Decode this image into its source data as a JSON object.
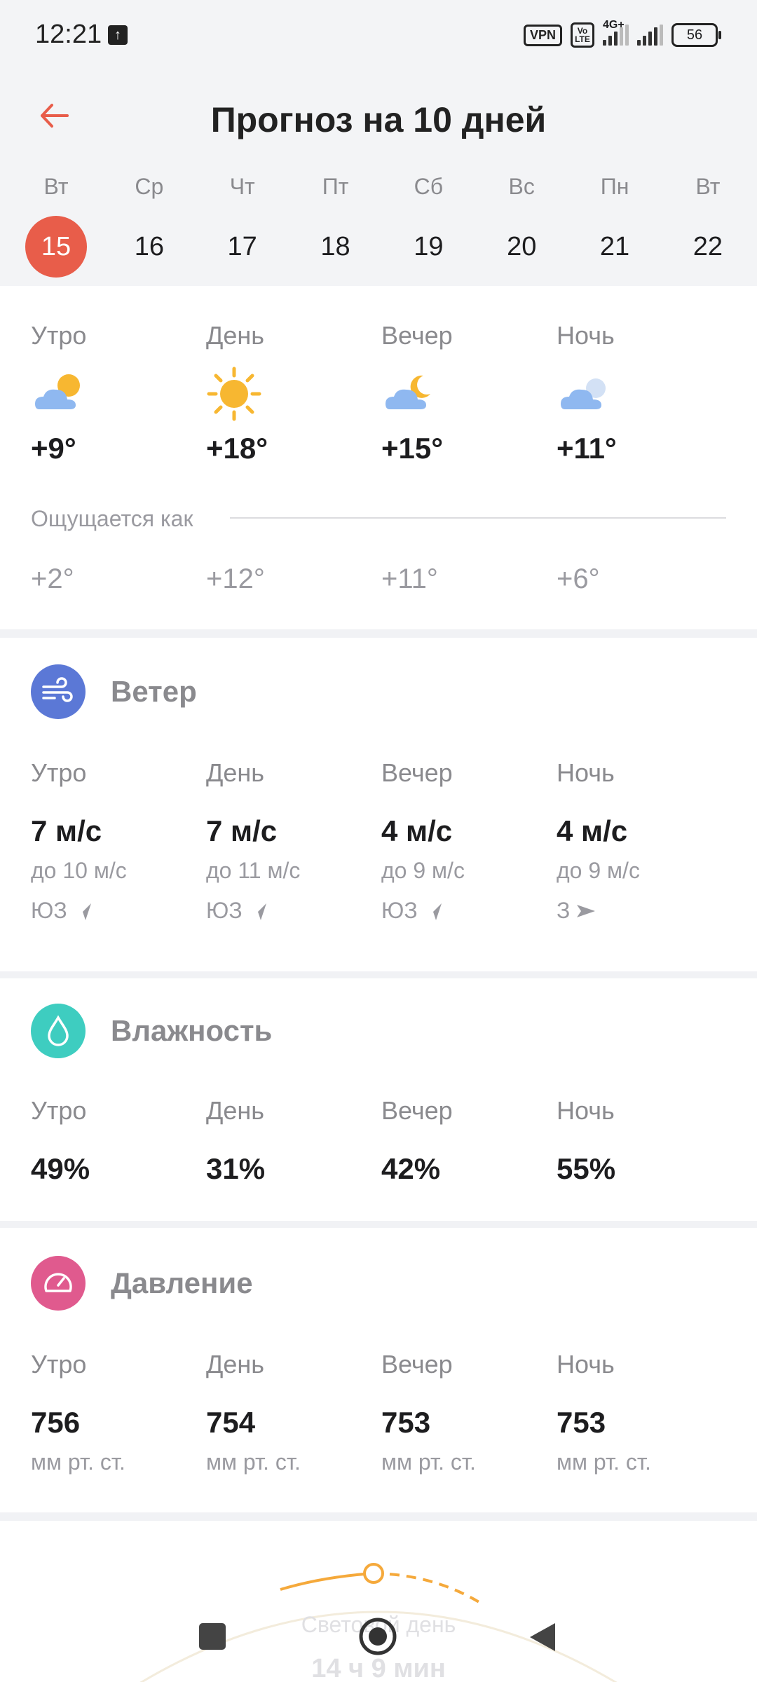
{
  "status": {
    "time": "12:21",
    "vpn": "VPN",
    "volte": "Vo LTE",
    "net": "4G+",
    "battery": "56"
  },
  "header": {
    "title": "Прогноз на 10 дней"
  },
  "days": [
    {
      "dow": "Вт",
      "num": "15",
      "active": true
    },
    {
      "dow": "Ср",
      "num": "16"
    },
    {
      "dow": "Чт",
      "num": "17"
    },
    {
      "dow": "Пт",
      "num": "18"
    },
    {
      "dow": "Сб",
      "num": "19"
    },
    {
      "dow": "Вс",
      "num": "20"
    },
    {
      "dow": "Пн",
      "num": "21"
    },
    {
      "dow": "Вт",
      "num": "22"
    }
  ],
  "forecast": {
    "periods": [
      {
        "label": "Утро",
        "temp": "+9°",
        "feels": "+2°",
        "icon": "partly-cloudy-day-icon"
      },
      {
        "label": "День",
        "temp": "+18°",
        "feels": "+12°",
        "icon": "sun-icon"
      },
      {
        "label": "Вечер",
        "temp": "+15°",
        "feels": "+11°",
        "icon": "partly-cloudy-night-icon"
      },
      {
        "label": "Ночь",
        "temp": "+11°",
        "feels": "+6°",
        "icon": "cloudy-night-icon"
      }
    ],
    "feels_label": "Ощущается как"
  },
  "wind": {
    "title": "Ветер",
    "periods": [
      {
        "label": "Утро",
        "speed": "7 м/с",
        "gust": "до 10 м/с",
        "dir": "ЮЗ"
      },
      {
        "label": "День",
        "speed": "7 м/с",
        "gust": "до 11 м/с",
        "dir": "ЮЗ"
      },
      {
        "label": "Вечер",
        "speed": "4 м/с",
        "gust": "до 9 м/с",
        "dir": "ЮЗ"
      },
      {
        "label": "Ночь",
        "speed": "4 м/с",
        "gust": "до 9 м/с",
        "dir": "З"
      }
    ]
  },
  "humidity": {
    "title": "Влажность",
    "periods": [
      {
        "label": "Утро",
        "value": "49%"
      },
      {
        "label": "День",
        "value": "31%"
      },
      {
        "label": "Вечер",
        "value": "42%"
      },
      {
        "label": "Ночь",
        "value": "55%"
      }
    ]
  },
  "pressure": {
    "title": "Давление",
    "unit": "мм рт. ст.",
    "periods": [
      {
        "label": "Утро",
        "value": "756"
      },
      {
        "label": "День",
        "value": "754"
      },
      {
        "label": "Вечер",
        "value": "753"
      },
      {
        "label": "Ночь",
        "value": "753"
      }
    ]
  },
  "daylight": {
    "label": "Световой день",
    "duration": "14 ч 9 мин"
  },
  "colors": {
    "accent": "#e85d4a",
    "wind": "#5b78d6",
    "humidity": "#3ecdc0",
    "pressure": "#e05a8e",
    "sun": "#f5a93b"
  }
}
